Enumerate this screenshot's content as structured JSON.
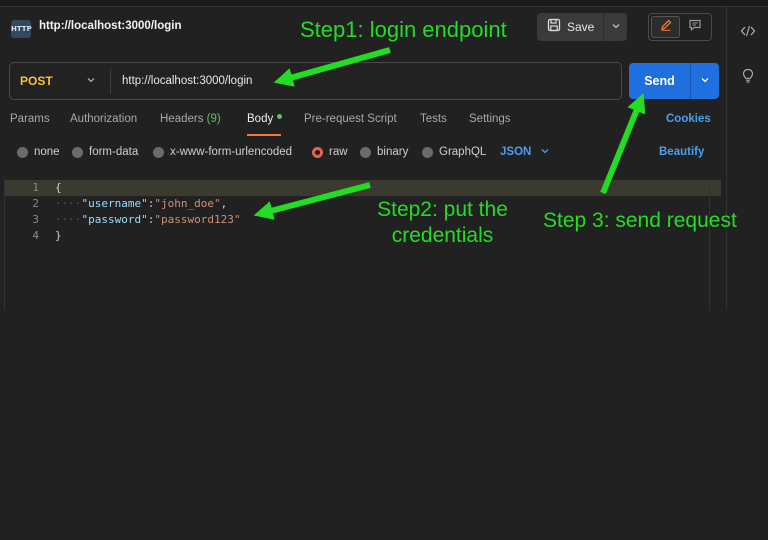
{
  "request": {
    "badge_text": "HTTP",
    "title": "http://localhost:3000/login",
    "method": "POST",
    "url": "http://localhost:3000/login"
  },
  "toolbar": {
    "save_label": "Save",
    "send_label": "Send"
  },
  "tabs": [
    {
      "label": "Params"
    },
    {
      "label": "Authorization"
    },
    {
      "label": "Headers",
      "count": "(9)"
    },
    {
      "label": "Body",
      "active": true,
      "has_dot": true
    },
    {
      "label": "Pre-request Script"
    },
    {
      "label": "Tests"
    },
    {
      "label": "Settings"
    }
  ],
  "cookies_label": "Cookies",
  "body_modes": [
    {
      "label": "none",
      "checked": false
    },
    {
      "label": "form-data",
      "checked": false
    },
    {
      "label": "x-www-form-urlencoded",
      "checked": false
    },
    {
      "label": "raw",
      "checked": true
    },
    {
      "label": "binary",
      "checked": false
    },
    {
      "label": "GraphQL",
      "checked": false
    }
  ],
  "language_select": "JSON",
  "beautify_label": "Beautify",
  "editor": {
    "line_numbers": [
      "1",
      "2",
      "3",
      "4"
    ],
    "open_brace": "{",
    "close_brace": "}",
    "fields": [
      {
        "key": "\"username\"",
        "value": "\"john_doe\"",
        "trail": ","
      },
      {
        "key": "\"password\"",
        "value": "\"password123\"",
        "trail": ""
      }
    ]
  },
  "annotations": {
    "step1": "Step1: login endpoint",
    "step2": "Step2: put the credentials",
    "step3": "Step 3: send request"
  },
  "colors": {
    "annotation": "#22dd22",
    "method": "#f4c430",
    "send_button": "#1f6fde",
    "link": "#4a9ff0",
    "active_tab_underline": "#f07b36"
  },
  "icons": {
    "rail_top": "code-icon",
    "rail_second": "lightbulb-icon",
    "save": "floppy-disk-icon",
    "edit": "pencil-icon",
    "comment": "comment-icon"
  }
}
